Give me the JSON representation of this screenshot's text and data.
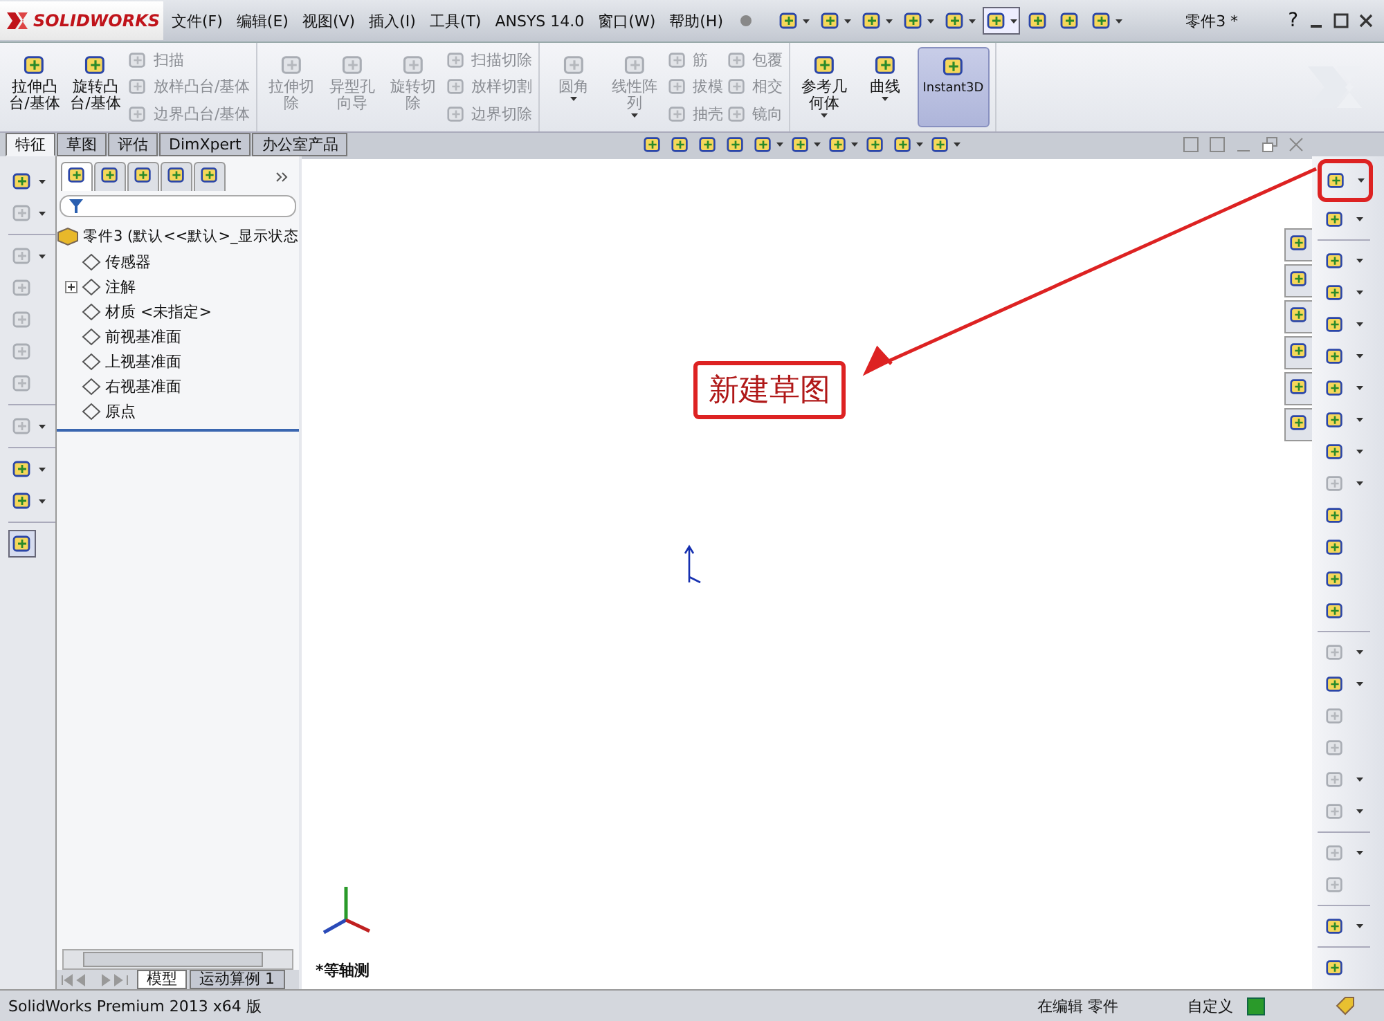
{
  "title_bar": {
    "logo": "SOLIDWORKS",
    "menus": [
      "文件(F)",
      "编辑(E)",
      "视图(V)",
      "插入(I)",
      "工具(T)",
      "ANSYS 14.0",
      "窗口(W)",
      "帮助(H)"
    ],
    "quick_tools": [
      {
        "dropdown": true,
        "selected": false
      },
      {
        "dropdown": true,
        "selected": false
      },
      {
        "dropdown": true,
        "selected": false
      },
      {
        "dropdown": true,
        "selected": false
      },
      {
        "dropdown": true,
        "selected": false
      },
      {
        "dropdown": true,
        "selected": true
      },
      {
        "dropdown": false,
        "selected": false
      },
      {
        "dropdown": false,
        "selected": false
      },
      {
        "dropdown": true,
        "selected": false
      }
    ],
    "document": "零件3 *",
    "help": "?"
  },
  "ribbon": {
    "groups": [
      {
        "large": [
          {
            "label": [
              "拉伸凸",
              "台/基体"
            ],
            "disabled": false,
            "dropdown": false,
            "selected": false
          },
          {
            "label": [
              "旋转凸",
              "台/基体"
            ],
            "disabled": false,
            "dropdown": false,
            "selected": false
          }
        ],
        "columns": [
          [
            {
              "label": "扫描",
              "disabled": true
            },
            {
              "label": "放样凸台/基体",
              "disabled": true
            },
            {
              "label": "边界凸台/基体",
              "disabled": true
            }
          ]
        ]
      },
      {
        "large": [
          {
            "label": [
              "拉伸切",
              "除"
            ],
            "disabled": true,
            "dropdown": false,
            "selected": false
          },
          {
            "label": [
              "异型孔",
              "向导"
            ],
            "disabled": true,
            "dropdown": false,
            "selected": false
          },
          {
            "label": [
              "旋转切",
              "除"
            ],
            "disabled": true,
            "dropdown": false,
            "selected": false
          }
        ],
        "columns": [
          [
            {
              "label": "扫描切除",
              "disabled": true
            },
            {
              "label": "放样切割",
              "disabled": true
            },
            {
              "label": "边界切除",
              "disabled": true
            }
          ]
        ]
      },
      {
        "large": [
          {
            "label": [
              "圆角"
            ],
            "disabled": true,
            "dropdown": true,
            "selected": false
          },
          {
            "label": [
              "线性阵",
              "列"
            ],
            "disabled": true,
            "dropdown": true,
            "selected": false
          }
        ],
        "columns": [
          [
            {
              "label": "筋",
              "disabled": true
            },
            {
              "label": "拔模",
              "disabled": true
            },
            {
              "label": "抽壳",
              "disabled": true
            }
          ],
          [
            {
              "label": "包覆",
              "disabled": true
            },
            {
              "label": "相交",
              "disabled": true
            },
            {
              "label": "镜向",
              "disabled": true
            }
          ]
        ]
      },
      {
        "large": [
          {
            "label": [
              "参考几",
              "何体"
            ],
            "disabled": false,
            "dropdown": true,
            "selected": false
          },
          {
            "label": [
              "曲线"
            ],
            "disabled": false,
            "dropdown": true,
            "selected": false
          },
          {
            "label": [
              "Instant3D"
            ],
            "disabled": false,
            "dropdown": false,
            "selected": true
          }
        ]
      }
    ]
  },
  "command_tabs": [
    {
      "label": "特征",
      "selected": true
    },
    {
      "label": "草图",
      "selected": false
    },
    {
      "label": "评估",
      "selected": false
    },
    {
      "label": "DimXpert",
      "selected": false
    },
    {
      "label": "办公室产品",
      "selected": false
    }
  ],
  "left_toolbar": [
    {
      "kind": "tool",
      "disabled": false,
      "dropdown": true,
      "selected": false
    },
    {
      "kind": "tool",
      "disabled": true,
      "dropdown": true,
      "selected": false
    },
    {
      "kind": "separator"
    },
    {
      "kind": "tool",
      "disabled": true,
      "dropdown": true,
      "selected": false
    },
    {
      "kind": "tool",
      "disabled": true,
      "dropdown": false,
      "selected": false
    },
    {
      "kind": "tool",
      "disabled": true,
      "dropdown": false,
      "selected": false
    },
    {
      "kind": "tool",
      "disabled": true,
      "dropdown": false,
      "selected": false
    },
    {
      "kind": "tool",
      "disabled": true,
      "dropdown": false,
      "selected": false
    },
    {
      "kind": "separator"
    },
    {
      "kind": "tool",
      "disabled": true,
      "dropdown": true,
      "selected": false
    },
    {
      "kind": "separator"
    },
    {
      "kind": "tool",
      "disabled": false,
      "dropdown": true,
      "selected": false
    },
    {
      "kind": "tool",
      "disabled": false,
      "dropdown": true,
      "selected": false
    },
    {
      "kind": "separator"
    },
    {
      "kind": "tool",
      "disabled": false,
      "dropdown": false,
      "selected": true
    }
  ],
  "feature_tree": {
    "tabs": [
      {
        "selected": true
      },
      {
        "selected": false
      },
      {
        "selected": false
      },
      {
        "selected": false
      },
      {
        "selected": false
      }
    ],
    "root": {
      "label": "零件3  (默认<<默认>_显示状态",
      "children": [
        {
          "label": "传感器"
        },
        {
          "label": "注解",
          "expanded": false
        },
        {
          "label": "材质 <未指定>"
        },
        {
          "label": "前视基准面"
        },
        {
          "label": "上视基准面"
        },
        {
          "label": "右视基准面"
        },
        {
          "label": "原点"
        }
      ]
    }
  },
  "view_toolbar": [
    {
      "dropdown": false
    },
    {
      "dropdown": false
    },
    {
      "dropdown": false
    },
    {
      "dropdown": false
    },
    {
      "dropdown": true
    },
    {
      "dropdown": true
    },
    {
      "dropdown": true
    },
    {
      "dropdown": false
    },
    {
      "dropdown": true
    },
    {
      "dropdown": true
    }
  ],
  "viewport": {
    "view_label": "*等轴测"
  },
  "annotation": {
    "text": "新建草图"
  },
  "task_pane_tabs": [
    {
      "selected": false
    },
    {
      "selected": false
    },
    {
      "selected": false
    },
    {
      "selected": false
    },
    {
      "selected": false
    },
    {
      "selected": false
    }
  ],
  "right_toolbar": [
    {
      "kind": "tool",
      "disabled": false,
      "dropdown": true,
      "highlighted": true
    },
    {
      "kind": "tool",
      "disabled": false,
      "dropdown": true,
      "highlighted": false
    },
    {
      "kind": "separator"
    },
    {
      "kind": "tool",
      "disabled": false,
      "dropdown": true,
      "highlighted": false
    },
    {
      "kind": "tool",
      "disabled": false,
      "dropdown": true,
      "highlighted": false
    },
    {
      "kind": "tool",
      "disabled": false,
      "dropdown": true,
      "highlighted": false
    },
    {
      "kind": "tool",
      "disabled": false,
      "dropdown": true,
      "highlighted": false
    },
    {
      "kind": "tool",
      "disabled": false,
      "dropdown": true,
      "highlighted": false
    },
    {
      "kind": "tool",
      "disabled": false,
      "dropdown": true,
      "highlighted": false
    },
    {
      "kind": "tool",
      "disabled": false,
      "dropdown": true,
      "highlighted": false
    },
    {
      "kind": "tool",
      "disabled": true,
      "dropdown": true,
      "highlighted": false
    },
    {
      "kind": "tool",
      "disabled": false,
      "dropdown": false,
      "highlighted": false
    },
    {
      "kind": "tool",
      "disabled": false,
      "dropdown": false,
      "highlighted": false
    },
    {
      "kind": "tool",
      "disabled": false,
      "dropdown": false,
      "highlighted": false
    },
    {
      "kind": "tool",
      "disabled": false,
      "dropdown": false,
      "highlighted": false
    },
    {
      "kind": "separator"
    },
    {
      "kind": "tool",
      "disabled": true,
      "dropdown": true,
      "highlighted": false
    },
    {
      "kind": "tool",
      "disabled": false,
      "dropdown": true,
      "highlighted": false
    },
    {
      "kind": "tool",
      "disabled": true,
      "dropdown": false,
      "highlighted": false
    },
    {
      "kind": "tool",
      "disabled": true,
      "dropdown": false,
      "highlighted": false
    },
    {
      "kind": "tool",
      "disabled": true,
      "dropdown": true,
      "highlighted": false
    },
    {
      "kind": "tool",
      "disabled": true,
      "dropdown": true,
      "highlighted": false
    },
    {
      "kind": "separator"
    },
    {
      "kind": "tool",
      "disabled": true,
      "dropdown": true,
      "highlighted": false
    },
    {
      "kind": "tool",
      "disabled": true,
      "dropdown": false,
      "highlighted": false
    },
    {
      "kind": "separator"
    },
    {
      "kind": "tool",
      "disabled": false,
      "dropdown": true,
      "highlighted": false
    },
    {
      "kind": "separator"
    },
    {
      "kind": "tool",
      "disabled": false,
      "dropdown": false,
      "highlighted": false
    }
  ],
  "bottom_tabs": [
    {
      "label": "模型",
      "selected": true
    },
    {
      "label": "运动算例 1",
      "selected": false
    }
  ],
  "status_bar": {
    "product": "SolidWorks Premium 2013 x64 版",
    "mode": "在编辑 零件",
    "units": "自定义"
  }
}
